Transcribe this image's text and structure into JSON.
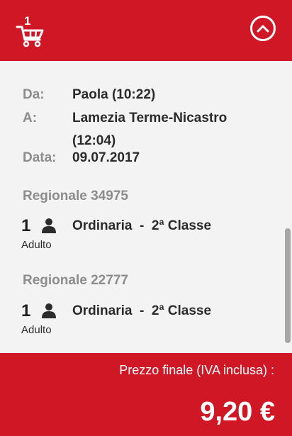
{
  "header": {
    "cart_count": "1",
    "cart_icon": "shopping-cart-icon",
    "collapse_icon": "chevron-up-circle-icon",
    "color": "#d01725"
  },
  "trip": {
    "from_label": "Da:",
    "from_value": "Paola (10:22)",
    "to_label": "A:",
    "to_value_line1": "Lamezia Terme-Nicastro",
    "to_value_line2": "(12:04)",
    "date_label": "Data:",
    "date_value": "09.07.2017"
  },
  "segments": [
    {
      "train": "Regionale  34975",
      "quantity": "1",
      "passenger_icon": "person-icon",
      "fare": "Ordinaria  -  2ª Classe",
      "passenger_type": "Adulto"
    },
    {
      "train": "Regionale  22777",
      "quantity": "1",
      "passenger_icon": "person-icon",
      "fare": "Ordinaria  -  2ª Classe",
      "passenger_type": "Adulto"
    }
  ],
  "footer": {
    "price_label": "Prezzo finale (IVA inclusa) :",
    "price": "9,20 €"
  }
}
